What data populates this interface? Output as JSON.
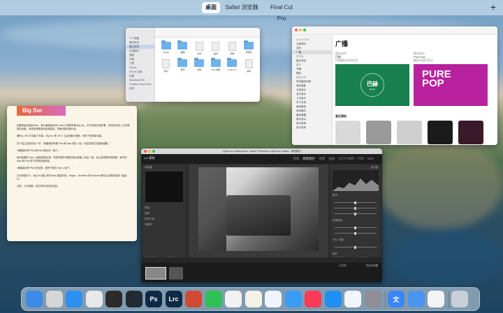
{
  "spaces_bar": {
    "tabs": [
      "桌面",
      "Safari 浏览器",
      "Final Cut Pro"
    ],
    "active_index": 0,
    "add_label": "+"
  },
  "finder": {
    "sidebar": [
      "个人收藏",
      "隔空投送",
      "最近使用",
      "应用程序",
      "桌面",
      "文稿",
      "下载",
      "iCloud",
      "iCloud 云盘",
      "位置",
      "Macintosh HD",
      "Creative Cloud Files",
      "标签"
    ],
    "items": [
      "Adobe",
      "截图",
      "文件",
      "备份",
      "项目",
      "未命名",
      "照片",
      "音乐",
      "文稿",
      "Vivo 视频",
      "Final Cut",
      "资料"
    ]
  },
  "music": {
    "sidebar": [
      "Apple Music",
      "立即收听",
      "浏览",
      "广播",
      "资料库",
      "最近添加",
      "艺人",
      "专辑",
      "歌曲",
      "播放列表",
      "所有播放列表",
      "我的最爱",
      "古典音乐",
      "流行音乐",
      "工作音乐",
      "学习专用",
      "精选歌曲",
      "夜间模式",
      "晨间唤醒",
      "周末派对",
      "旅行歌单",
      "音乐现场"
    ],
    "selected_sidebar": "广播",
    "title": "广播",
    "cards": [
      {
        "kicker": "精选电台",
        "name": "巴赫",
        "sub": "巴赫最出名的作品",
        "art_text": "巴赫",
        "art_sub": "BACH"
      },
      {
        "kicker": "精选电台",
        "name": "Pure Pop",
        "sub": "最好的流行音乐",
        "art_text": "PURE POP"
      }
    ],
    "recent_label": "最近播放"
  },
  "notes": {
    "banner": "Big Sur",
    "paragraphs": [
      "如果你喜欢使用 Mac，那么最新版本的 macOS 就是苹果 Big Sur。并不是说它更好看，但是在技术上它变得更加完善，系统变得更加简洁和高效，界面也更加现代化。",
      "图形从 iOS 中汲取了灵感，Big Sur 是 OS X 之后的最大更新，带来了很多新功能。",
      "在介绍之前我先说一句：“把最新的苹果 iPad 和 Mac 放在一起，你会发现它们越来越像。”",
      "“我最喜欢的 iPad 和 Mac 融合在一起了。”",
      "每次我都在 Mac 上使用各种应用，同样的操作流程在两台设备上完全一致，这让我觉得非常舒服。我们的 Mac 和 iPad 终于变得无缝衔接。",
      "“我最喜欢的 iPad 在这里，我终于能在 Mac 上用了。”",
      "无论你做什么，Big Sur 都让你的 Mac 更加好用。Pages、Numbers 和 Keynote 都可以在新系统里一起运行。",
      "当然，今天更新，真正的好戏还在后面。"
    ]
  },
  "lightroom": {
    "window_title": "Lightroom Catalog.lrcat - Adobe Photoshop Lightroom Classic - 修改照片",
    "brand": "Lrc 菲克",
    "modules": [
      "图库",
      "修改照片",
      "地图",
      "画册",
      "幻灯片放映",
      "打印",
      "Web"
    ],
    "active_module": "修改照片",
    "left_panel": [
      "导航器",
      "预设",
      "快照",
      "历史记录",
      "收藏夹"
    ],
    "right_panel": [
      "直方图",
      "基本",
      "色调曲线",
      "HSL / 颜色",
      "细节"
    ],
    "buttons": {
      "copy": "复制...",
      "paste": "粘贴",
      "previous": "上一张",
      "reset": "复位"
    },
    "filter_label": "过滤器：",
    "filter_value": "关闭过滤器"
  },
  "dock": {
    "apps": [
      {
        "name": "finder-icon",
        "label": "",
        "color": "#3d8be6"
      },
      {
        "name": "launchpad-icon",
        "label": "",
        "color": "#d6d6d6"
      },
      {
        "name": "safari-icon",
        "label": "",
        "color": "#2d8ff0"
      },
      {
        "name": "chrome-icon",
        "label": "",
        "color": "#e8e8e8"
      },
      {
        "name": "final-cut-pro-icon",
        "label": "",
        "color": "#2b2b2b"
      },
      {
        "name": "davinci-resolve-icon",
        "label": "",
        "color": "#222a33"
      },
      {
        "name": "photoshop-icon",
        "label": "Ps",
        "color": "#0d2a45"
      },
      {
        "name": "lightroom-classic-icon",
        "label": "Lrc",
        "color": "#0f2a44"
      },
      {
        "name": "folder-icon",
        "label": "",
        "color": "#d04a35"
      },
      {
        "name": "wechat-icon",
        "label": "",
        "color": "#2dc158"
      },
      {
        "name": "craft-icon",
        "label": "",
        "color": "#f2f2f2"
      },
      {
        "name": "pencil-app-icon",
        "label": "",
        "color": "#f4f1e6"
      },
      {
        "name": "omnifocus-icon",
        "label": "",
        "color": "#eef5ff"
      },
      {
        "name": "mail-icon",
        "label": "",
        "color": "#3a9bf4"
      },
      {
        "name": "music-icon",
        "label": "",
        "color": "#fb3a55"
      },
      {
        "name": "app-store-icon",
        "label": "",
        "color": "#1f8ff4"
      },
      {
        "name": "cloud-icon",
        "label": "",
        "color": "#f2f5fb"
      },
      {
        "name": "system-preferences-icon",
        "label": "",
        "color": "#8f8f95"
      },
      {
        "name": "translate-icon",
        "label": "文",
        "color": "#3b86f6"
      },
      {
        "name": "dictionary-icon",
        "label": "",
        "color": "#4b94f0"
      },
      {
        "name": "app-icon",
        "label": "",
        "color": "#f4f4f6"
      },
      {
        "name": "trash-icon",
        "label": "",
        "color": "#c9cfd6"
      }
    ]
  },
  "colors": {
    "accent": "#2f7ff0",
    "bach": "#17804e",
    "purepop": "#b8229e",
    "lightroom_bg": "#2b2b2b"
  }
}
